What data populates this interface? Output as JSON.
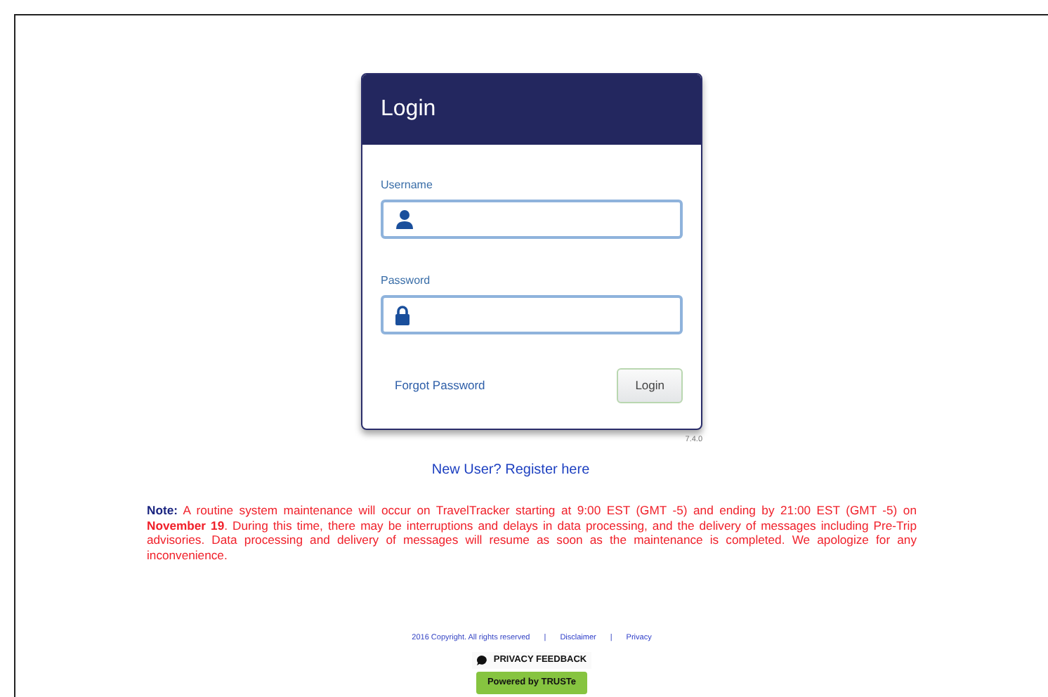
{
  "login_panel": {
    "title": "Login",
    "username": {
      "label": "Username"
    },
    "password": {
      "label": "Password"
    },
    "forgot_link": "Forgot Password",
    "login_button": "Login"
  },
  "version": "7.4.0",
  "register_link": "New User? Register here",
  "notice": {
    "text": "**Note:** A routine system maintenance will occur on TravelTracker starting at 9:00 EST (GMT -5) and ending by 21:00 EST (GMT -5) on **November 19**. During this time, there may be interruptions and delays in data processing, and the delivery of messages including Pre-Trip advisories. Data processing and delivery of messages will resume as soon as the maintenance is completed. We apologize for any inconvenience."
  },
  "footer": {
    "links": [
      {
        "kind": "text",
        "text": "2016 Copyright. All rights reserved"
      },
      {
        "kind": "separator",
        "text": "|"
      },
      {
        "kind": "link",
        "text": "Disclaimer"
      },
      {
        "kind": "separator",
        "text": "|"
      },
      {
        "kind": "link",
        "text": "Privacy"
      }
    ],
    "privacy_badge": "PRIVACY FEEDBACK",
    "truste_badge": "Powered by TRUSTe"
  }
}
